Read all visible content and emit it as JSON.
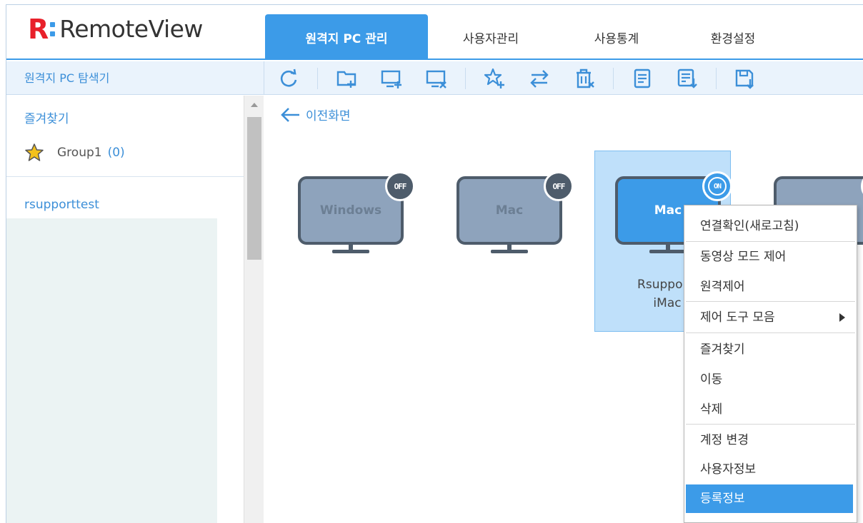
{
  "logo": {
    "mark": "R",
    "text": "RemoteView"
  },
  "nav": {
    "tabs": [
      {
        "label": "원격지 PC 관리",
        "active": true
      },
      {
        "label": "사용자관리",
        "active": false
      },
      {
        "label": "사용통계",
        "active": false
      },
      {
        "label": "환경설정",
        "active": false
      }
    ]
  },
  "left_panel": {
    "title": "원격지 PC 탐색기",
    "favorites_title": "즐겨찾기",
    "favorite_group": {
      "name": "Group1",
      "count": "(0)"
    },
    "tree_root": "rsupporttest"
  },
  "toolbar": {
    "icons": [
      "refresh-icon",
      "add-group-icon",
      "add-pc-icon",
      "remove-pc-icon",
      "add-favorite-icon",
      "move-icon",
      "delete-icon",
      "memo-icon",
      "download-list-icon",
      "export-icon"
    ]
  },
  "main": {
    "back_label": "이전화면",
    "pcs": [
      {
        "os": "Windows",
        "status": "OFF",
        "name": ""
      },
      {
        "os": "Mac",
        "status": "OFF",
        "name": ""
      },
      {
        "os": "Mac",
        "status": "ON",
        "name_line1": "Rsupport!",
        "name_line2": "iMac",
        "selected": true
      },
      {
        "os": "",
        "status": ""
      }
    ]
  },
  "context_menu": {
    "items": [
      "연결확인(새로고침)",
      "동영상 모드 제어",
      "원격제어",
      "제어 도구 모음",
      "즐겨찾기",
      "이동",
      "삭제",
      "계정 변경",
      "사용자정보",
      "등록정보"
    ],
    "highlighted_index": 9
  },
  "colors": {
    "accent": "#3c9be8",
    "logo_red": "#e8202a",
    "monitor_off": "#8ea3bc",
    "monitor_on": "#3c9be8",
    "selection_bg": "#bfe0fa"
  }
}
